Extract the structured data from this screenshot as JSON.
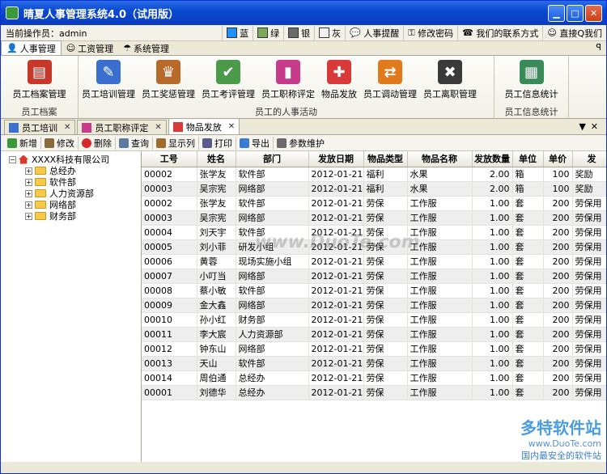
{
  "window": {
    "title": "晴夏人事管理系统4.0（试用版）"
  },
  "topbar": {
    "operator": "当前操作员：admin",
    "themes": [
      {
        "label": "蓝",
        "color": "#1e90ff"
      },
      {
        "label": "绿",
        "color": "#7caa5a"
      },
      {
        "label": "银",
        "color": "#6b6b6b"
      },
      {
        "label": "灰",
        "color": "#f0f0f0"
      }
    ],
    "reminder": "人事提醒",
    "password": "修改密码",
    "contact": "我们的联系方式",
    "qq": "直接Q我们"
  },
  "menutabs": [
    "人事管理",
    "工资管理",
    "系统管理"
  ],
  "ribbon": {
    "groups": [
      {
        "label": "员工档案",
        "items": [
          {
            "label": "员工档案管理",
            "icon": "archive-icon",
            "color": "#c8382a"
          }
        ]
      },
      {
        "label": "员工的人事活动",
        "items": [
          {
            "label": "员工培训管理",
            "icon": "training-icon",
            "color": "#3a6fd0"
          },
          {
            "label": "员工奖惩管理",
            "icon": "trophy-icon",
            "color": "#b86a2a"
          },
          {
            "label": "员工考评管理",
            "icon": "evaluation-icon",
            "color": "#4a9a4a"
          },
          {
            "label": "员工职称评定",
            "icon": "title-chart-icon",
            "color": "#c83a8a"
          },
          {
            "label": "物品发放",
            "icon": "gift-icon",
            "color": "#d83a3a"
          },
          {
            "label": "员工调动管理",
            "icon": "transfer-icon",
            "color": "#e07a1a"
          },
          {
            "label": "员工离职管理",
            "icon": "resign-icon",
            "color": "#3a3a3a"
          }
        ]
      },
      {
        "label": "员工信息统计",
        "items": [
          {
            "label": "员工信息统计",
            "icon": "statistics-icon",
            "color": "#3a8a5a"
          }
        ]
      }
    ]
  },
  "doctabs": [
    {
      "label": "员工培训",
      "color": "#3a6fd0",
      "active": false
    },
    {
      "label": "员工职称评定",
      "color": "#c83a8a",
      "active": false
    },
    {
      "label": "物品发放",
      "color": "#d83a3a",
      "active": true
    }
  ],
  "toolbar": [
    {
      "label": "新增",
      "icon": "add-icon",
      "color": "#3a9a3a"
    },
    {
      "label": "修改",
      "icon": "edit-icon",
      "color": "#8a6a3a"
    },
    {
      "label": "删除",
      "icon": "delete-icon",
      "color": "#d8282a"
    },
    {
      "label": "查询",
      "icon": "search-icon",
      "color": "#5a7aa0"
    },
    {
      "label": "显示列",
      "icon": "columns-icon",
      "color": "#a06a2a"
    },
    {
      "label": "打印",
      "icon": "print-icon",
      "color": "#5a5a8a"
    },
    {
      "label": "导出",
      "icon": "export-icon",
      "color": "#3a7ad0"
    },
    {
      "label": "参数维护",
      "icon": "settings-icon",
      "color": "#6a6a6a"
    }
  ],
  "tree": {
    "root": "XXXX科技有限公司",
    "children": [
      "总经办",
      "软件部",
      "人力资源部",
      "网络部",
      "财务部"
    ]
  },
  "table": {
    "columns": [
      "工号",
      "姓名",
      "部门",
      "发放日期",
      "物品类型",
      "物品名称",
      "发放数量",
      "单位",
      "单价",
      "发"
    ],
    "rows": [
      [
        "00002",
        "张学友",
        "软件部",
        "2012-01-21",
        "福利",
        "水果",
        "2.00",
        "箱",
        "100",
        "奖励"
      ],
      [
        "00003",
        "吴宗宪",
        "网络部",
        "2012-01-21",
        "福利",
        "水果",
        "2.00",
        "箱",
        "100",
        "奖励"
      ],
      [
        "00002",
        "张学友",
        "软件部",
        "2012-01-21",
        "劳保",
        "工作服",
        "1.00",
        "套",
        "200",
        "劳保用"
      ],
      [
        "00003",
        "吴宗宪",
        "网络部",
        "2012-01-21",
        "劳保",
        "工作服",
        "1.00",
        "套",
        "200",
        "劳保用"
      ],
      [
        "00004",
        "刘天宇",
        "软件部",
        "2012-01-21",
        "劳保",
        "工作服",
        "1.00",
        "套",
        "200",
        "劳保用"
      ],
      [
        "00005",
        "刘小菲",
        "研发小组",
        "2012-01-21",
        "劳保",
        "工作服",
        "1.00",
        "套",
        "200",
        "劳保用"
      ],
      [
        "00006",
        "黄蓉",
        "现场实施小组",
        "2012-01-21",
        "劳保",
        "工作服",
        "1.00",
        "套",
        "200",
        "劳保用"
      ],
      [
        "00007",
        "小叮当",
        "网络部",
        "2012-01-21",
        "劳保",
        "工作服",
        "1.00",
        "套",
        "200",
        "劳保用"
      ],
      [
        "00008",
        "蔡小敏",
        "软件部",
        "2012-01-21",
        "劳保",
        "工作服",
        "1.00",
        "套",
        "200",
        "劳保用"
      ],
      [
        "00009",
        "金大鑫",
        "网络部",
        "2012-01-21",
        "劳保",
        "工作服",
        "1.00",
        "套",
        "200",
        "劳保用"
      ],
      [
        "00010",
        "孙小红",
        "财务部",
        "2012-01-21",
        "劳保",
        "工作服",
        "1.00",
        "套",
        "200",
        "劳保用"
      ],
      [
        "00011",
        "李大宸",
        "人力资源部",
        "2012-01-21",
        "劳保",
        "工作服",
        "1.00",
        "套",
        "200",
        "劳保用"
      ],
      [
        "00012",
        "钟东山",
        "网络部",
        "2012-01-21",
        "劳保",
        "工作服",
        "1.00",
        "套",
        "200",
        "劳保用"
      ],
      [
        "00013",
        "天山",
        "软件部",
        "2012-01-21",
        "劳保",
        "工作服",
        "1.00",
        "套",
        "200",
        "劳保用"
      ],
      [
        "00014",
        "周伯通",
        "总经办",
        "2012-01-21",
        "劳保",
        "工作服",
        "1.00",
        "套",
        "200",
        "劳保用"
      ],
      [
        "00001",
        "刘德华",
        "总经办",
        "2012-01-21",
        "劳保",
        "工作服",
        "1.00",
        "套",
        "200",
        "劳保用"
      ]
    ]
  },
  "watermark": {
    "center": "www.DuoTe.com",
    "brand": "多特软件站",
    "site": "www.DuoTe.com",
    "slogan": "国内最安全的软件站"
  }
}
